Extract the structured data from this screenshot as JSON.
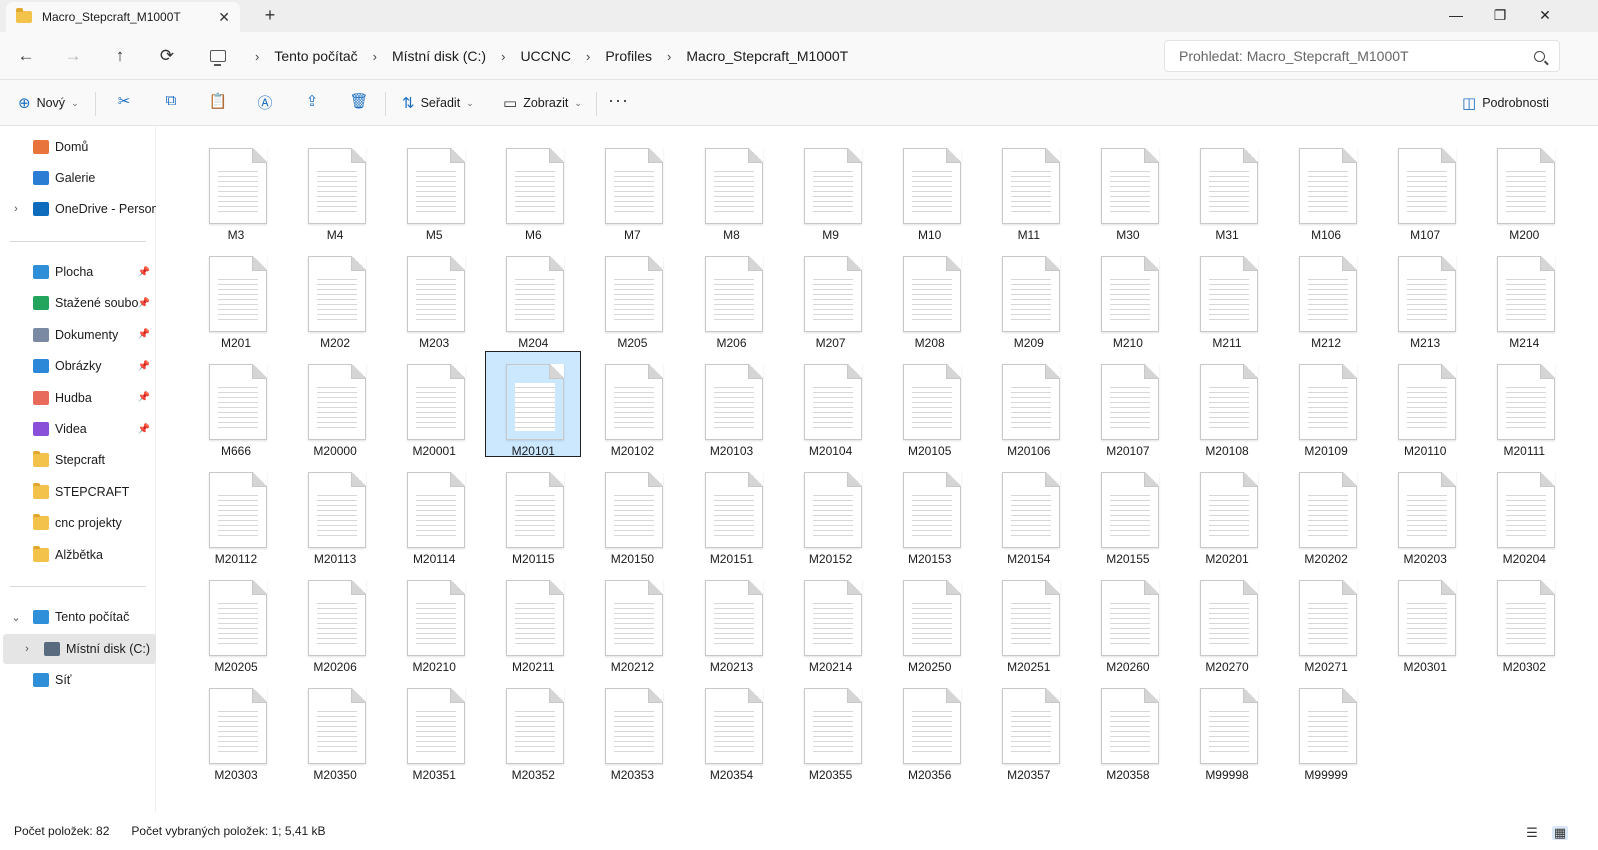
{
  "window": {
    "tab_title": "Macro_Stepcraft_M1000T",
    "tab_close": "✕",
    "new_tab": "+",
    "minimize": "—",
    "maximize": "❐",
    "close": "✕"
  },
  "nav": {
    "back": "←",
    "forward": "→",
    "up": "↑",
    "refresh": "⟳"
  },
  "breadcrumbs": [
    "Tento počítač",
    "Místní disk (C:)",
    "UCCNC",
    "Profiles",
    "Macro_Stepcraft_M1000T"
  ],
  "breadcrumb_separator": "›",
  "search": {
    "placeholder": "Prohledat: Macro_Stepcraft_M1000T"
  },
  "toolbar": {
    "new_label": "Nový",
    "sort_label": "Seřadit",
    "view_label": "Zobrazit",
    "more_label": "···",
    "details_label": "Podrobnosti",
    "icons": [
      "cut-icon",
      "copy-icon",
      "paste-icon",
      "rename-icon",
      "share-icon",
      "delete-icon"
    ]
  },
  "sidebar": {
    "quick": [
      {
        "label": "Domů",
        "icon": "home-icon",
        "color": "#e8743b"
      },
      {
        "label": "Galerie",
        "icon": "gallery-icon",
        "color": "#2b7cd3"
      },
      {
        "label": "OneDrive - Persona",
        "icon": "onedrive-icon",
        "color": "#0f6cbd",
        "expandable": true
      }
    ],
    "pinned": [
      {
        "label": "Plocha",
        "icon": "desktop-icon",
        "color": "#2f8fd8"
      },
      {
        "label": "Stažené soubory",
        "icon": "download-icon",
        "color": "#22a45d"
      },
      {
        "label": "Dokumenty",
        "icon": "documents-icon",
        "color": "#7a8aa3"
      },
      {
        "label": "Obrázky",
        "icon": "pictures-icon",
        "color": "#2b88d8"
      },
      {
        "label": "Hudba",
        "icon": "music-icon",
        "color": "#e86a5a"
      },
      {
        "label": "Videa",
        "icon": "videos-icon",
        "color": "#8a4fd8"
      }
    ],
    "folders": [
      "Stepcraft",
      "STEPCRAFT",
      "cnc projekty",
      "Alžbětka"
    ],
    "computer": [
      {
        "label": "Tento počítač",
        "icon": "computer-icon",
        "color": "#2f8fd8",
        "expanded": true
      },
      {
        "label": "Místní disk (C:)",
        "icon": "drive-icon",
        "color": "#5a6b80",
        "selected": true
      },
      {
        "label": "Síť",
        "icon": "network-icon",
        "color": "#2f8fd8"
      }
    ]
  },
  "files": [
    "M3",
    "M4",
    "M5",
    "M6",
    "M7",
    "M8",
    "M9",
    "M10",
    "M11",
    "M30",
    "M31",
    "M106",
    "M107",
    "M200",
    "M201",
    "M202",
    "M203",
    "M204",
    "M205",
    "M206",
    "M207",
    "M208",
    "M209",
    "M210",
    "M211",
    "M212",
    "M213",
    "M214",
    "M666",
    "M20000",
    "M20001",
    "M20101",
    "M20102",
    "M20103",
    "M20104",
    "M20105",
    "M20106",
    "M20107",
    "M20108",
    "M20109",
    "M20110",
    "M20111",
    "M20112",
    "M20113",
    "M20114",
    "M20115",
    "M20150",
    "M20151",
    "M20152",
    "M20153",
    "M20154",
    "M20155",
    "M20201",
    "M20202",
    "M20203",
    "M20204",
    "M20205",
    "M20206",
    "M20210",
    "M20211",
    "M20212",
    "M20213",
    "M20214",
    "M20250",
    "M20251",
    "M20260",
    "M20270",
    "M20271",
    "M20301",
    "M20302",
    "M20303",
    "M20350",
    "M20351",
    "M20352",
    "M20353",
    "M20354",
    "M20355",
    "M20356",
    "M20357",
    "M20358",
    "M99998",
    "M99999"
  ],
  "selected_file": "M20101",
  "status": {
    "item_count": "Počet položek: 82",
    "selected_info": "Počet vybraných položek: 1; 5,41 kB"
  },
  "colors": {
    "accent": "#1b6ec2",
    "selection": "#cce8ff",
    "folder": "#f2c24a"
  }
}
